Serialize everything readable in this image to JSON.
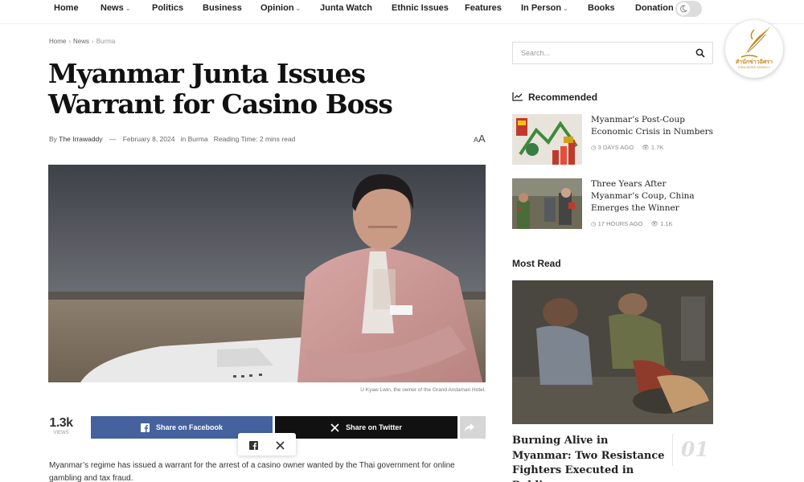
{
  "nav": {
    "items": [
      {
        "label": "Home",
        "dropdown": false
      },
      {
        "label": "News",
        "dropdown": true
      },
      {
        "label": "Politics",
        "dropdown": false
      },
      {
        "label": "Business",
        "dropdown": false
      },
      {
        "label": "Opinion",
        "dropdown": true
      },
      {
        "label": "Junta Watch",
        "dropdown": false
      },
      {
        "label": "Ethnic Issues",
        "dropdown": false
      },
      {
        "label": "Features",
        "dropdown": false
      },
      {
        "label": "In Person",
        "dropdown": true
      },
      {
        "label": "Books",
        "dropdown": false
      },
      {
        "label": "Donation",
        "dropdown": false
      }
    ],
    "dark_mode_icon": "moon-icon"
  },
  "logo": {
    "thai_text": "สำนักข่าวอิศรา",
    "english_text": "ISRA NEWS AGENCY"
  },
  "breadcrumb": [
    "Home",
    "News",
    "Burma"
  ],
  "article": {
    "title": "Myanmar Junta Issues Warrant for Casino Boss",
    "by_prefix": "By",
    "author": "The Irrawaddy",
    "date": "February 8, 2024",
    "in_prefix": "in",
    "category": "Burma",
    "reading_time": "Reading Time: 2 mins read",
    "font_size_label": "AA",
    "image_caption": "U Kyaw Lwin, the owner of the Grand Andaman Hotel.",
    "body_text": "Myanmar’s regime has issued a warrant for the arrest of a casino owner wanted by the Thai government for online gambling and tax fraud."
  },
  "share": {
    "count": "1.3k",
    "count_label": "VIEWS",
    "facebook_label": "Share on Facebook",
    "twitter_label": "Share on Twitter"
  },
  "sidebar": {
    "search_placeholder": "Search...",
    "recommended_title": "Recommended",
    "recommended": [
      {
        "title": "Myanmar’s Post-Coup Economic Crisis in Numbers",
        "time": "3 DAYS AGO",
        "views": "1.7K"
      },
      {
        "title": "Three Years After Myanmar’s Coup, China Emerges the Winner",
        "time": "17 HOURS AGO",
        "views": "1.1K"
      }
    ],
    "most_read_title": "Most Read",
    "most_read": [
      {
        "title": "Burning Alive in Myanmar: Two Resistance Fighters Executed in Public",
        "number": "01"
      }
    ]
  },
  "colors": {
    "facebook": "#45629f",
    "twitter": "#111111",
    "logo_gold": "#c58b1f"
  }
}
